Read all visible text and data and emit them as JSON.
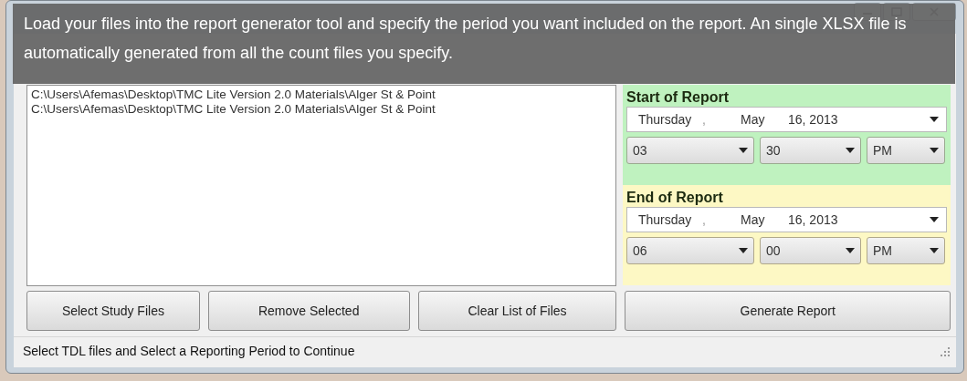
{
  "tooltip": "Load your files into the report generator tool and specify the period you want included on the report. An single XLSX file is automatically generated from all the count files you specify.",
  "files": [
    {
      "path": "C:\\Users\\Afemas\\Desktop\\TMC Lite Version 2.0 Materials\\Alger St & Point",
      "selected": false
    },
    {
      "path": "C:\\Users\\Afemas\\Desktop\\TMC Lite Version 2.0 Materials\\Alger St & Point",
      "selected": false
    }
  ],
  "periods": [
    {
      "kind": "start",
      "title": "Start of Report",
      "weekday": "Thursday",
      "separator": ",",
      "month": "May",
      "day_year": "16, 2013",
      "hour": "03",
      "minute": "30",
      "ampm": "PM"
    },
    {
      "kind": "end",
      "title": "End of Report",
      "weekday": "Thursday",
      "separator": ",",
      "month": "May",
      "day_year": "16, 2013",
      "hour": "06",
      "minute": "00",
      "ampm": "PM"
    }
  ],
  "buttons": [
    "Select Study Files",
    "Remove Selected",
    "Clear List of Files",
    "Generate Report"
  ],
  "status_bar": "Select TDL files and Select a Reporting Period to Continue"
}
